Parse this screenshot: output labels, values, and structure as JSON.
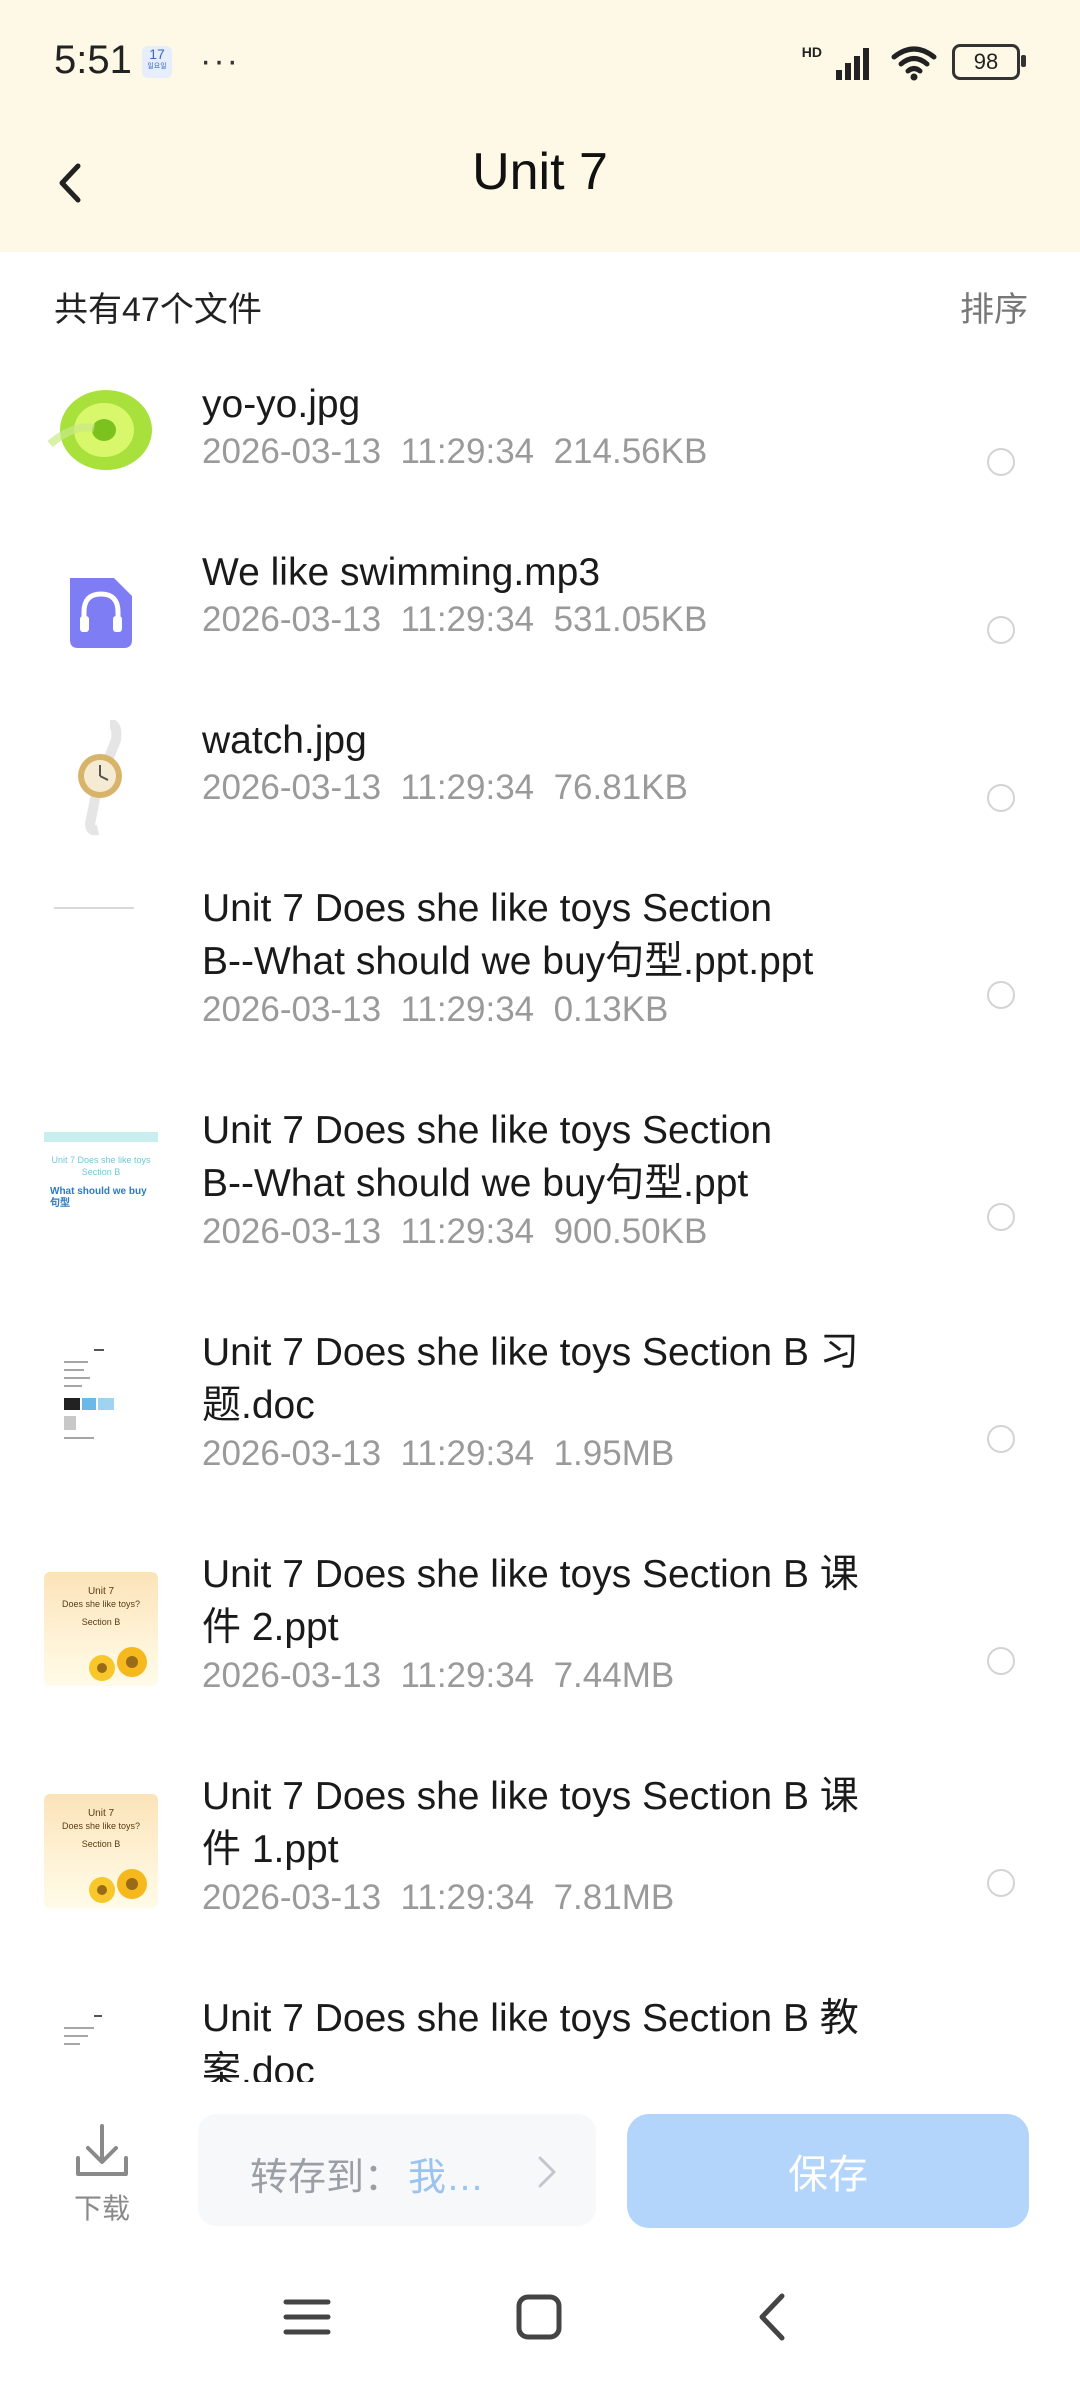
{
  "status_bar": {
    "time": "5:51",
    "calendar_badge": "17",
    "calendar_sub": "일요일",
    "more_dots": "···",
    "network": "HD",
    "battery": "98"
  },
  "header": {
    "title": "Unit 7"
  },
  "summary": {
    "count_text": "共有47个文件",
    "sort_label": "排序"
  },
  "files": [
    {
      "name": "yo-yo.jpg",
      "date": "2026-03-13  11:29:34",
      "size": "214.56KB",
      "icon": "yoyo-image-thumbnail"
    },
    {
      "name": "We like swimming.mp3",
      "date": "2026-03-13  11:29:34",
      "size": "531.05KB",
      "icon": "audio-headphones-icon"
    },
    {
      "name": "watch.jpg",
      "date": "2026-03-13  11:29:34",
      "size": "76.81KB",
      "icon": "watch-image-thumbnail"
    },
    {
      "name_line1": "Unit 7 Does she like toys Section",
      "name_line2": "B--What should we buy句型.ppt.ppt",
      "date": "2026-03-13  11:29:34",
      "size": "0.13KB",
      "icon": "blank-ppt-thumbnail"
    },
    {
      "name_line1": "Unit 7 Does she like toys Section",
      "name_line2": "B--What should we buy句型.ppt",
      "date": "2026-03-13  11:29:34",
      "size": "900.50KB",
      "icon": "ppt-slide-thumbnail",
      "thumb_text1": "Unit 7 Does she like toys",
      "thumb_text2": "Section B",
      "thumb_text3": "What should we buy 句型"
    },
    {
      "name_line1": "Unit 7 Does she like toys Section B 习",
      "name_line2": "题.doc",
      "date": "2026-03-13  11:29:34",
      "size": "1.95MB",
      "icon": "doc-page-thumbnail"
    },
    {
      "name_line1": "Unit 7 Does she like toys Section B 课",
      "name_line2": "件 2.ppt",
      "date": "2026-03-13  11:29:34",
      "size": "7.44MB",
      "icon": "ppt-sunflower-thumbnail",
      "thumb_text1": "Unit 7",
      "thumb_text2": "Does she like toys?",
      "thumb_text3": "Section B"
    },
    {
      "name_line1": "Unit 7 Does she like toys Section B 课",
      "name_line2": "件 1.ppt",
      "date": "2026-03-13  11:29:34",
      "size": "7.81MB",
      "icon": "ppt-sunflower-thumbnail",
      "thumb_text1": "Unit 7",
      "thumb_text2": "Does she like toys?",
      "thumb_text3": "Section B"
    },
    {
      "name_line1": "Unit 7 Does she like toys Section B 教",
      "name_line2": "案.doc",
      "icon": "doc-page-thumbnail"
    }
  ],
  "bottom_bar": {
    "download_label": "下载",
    "save_to_label": "转存到：",
    "save_to_target": "我…",
    "save_button": "保存"
  },
  "colors": {
    "header_bg": "#fdf9e6",
    "save_button_bg": "#b3d5fb",
    "audio_icon": "#7f7df3",
    "meta_text": "#9a9a9a"
  }
}
